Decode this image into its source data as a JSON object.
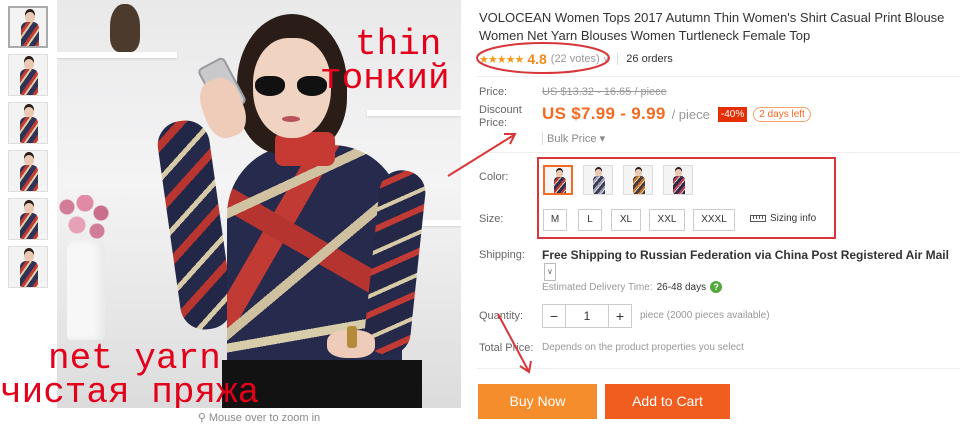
{
  "thumbnails": {
    "count": 6
  },
  "image": {
    "overlay_thin_en": "thin",
    "overlay_thin_ru": "тонкий",
    "overlay_yarn_en": "net yarn",
    "overlay_yarn_ru": "чистая пряжа",
    "zoom_hint": "Mouse over to zoom in"
  },
  "product": {
    "title": "VOLOCEAN Women Tops 2017 Autumn Thin Women's Shirt Casual Print Blouse Women Net Yarn Blouses Women Turtleneck Female Top",
    "rating": "4.8",
    "votes": "(22 votes)",
    "orders": "26 orders"
  },
  "price": {
    "label": "Price:",
    "original": "US $13.32 - 16.65 / piece",
    "discount_label_line1": "Discount",
    "discount_label_line2": "Price:",
    "discount": "US $7.99 - 9.99",
    "per": "/ piece",
    "off": "-40%",
    "time_left": "2 days left",
    "bulk": "Bulk Price"
  },
  "options": {
    "color_label": "Color:",
    "size_label": "Size:",
    "sizes": [
      "M",
      "L",
      "XL",
      "XXL",
      "XXXL"
    ],
    "sizing_info": "Sizing info",
    "colors": [
      "#2b2f52",
      "#3a3d5a",
      "#4a3a3a",
      "#2e2a44"
    ]
  },
  "shipping": {
    "label": "Shipping:",
    "text": "Free Shipping to Russian Federation via China Post Registered Air Mail",
    "est_label": "Estimated Delivery Time:",
    "est_value": "26-48 days"
  },
  "quantity": {
    "label": "Quantity:",
    "value": "1",
    "note": "piece (2000 pieces available)"
  },
  "total": {
    "label": "Total Price:",
    "value": "Depends on the product properties you select"
  },
  "actions": {
    "buy_now": "Buy Now",
    "add_to_cart": "Add to Cart"
  },
  "colors": {
    "accent": "#f36b23",
    "buy": "#f58d2c",
    "cart": "#f15d1e",
    "annotation": "#d8363a"
  }
}
